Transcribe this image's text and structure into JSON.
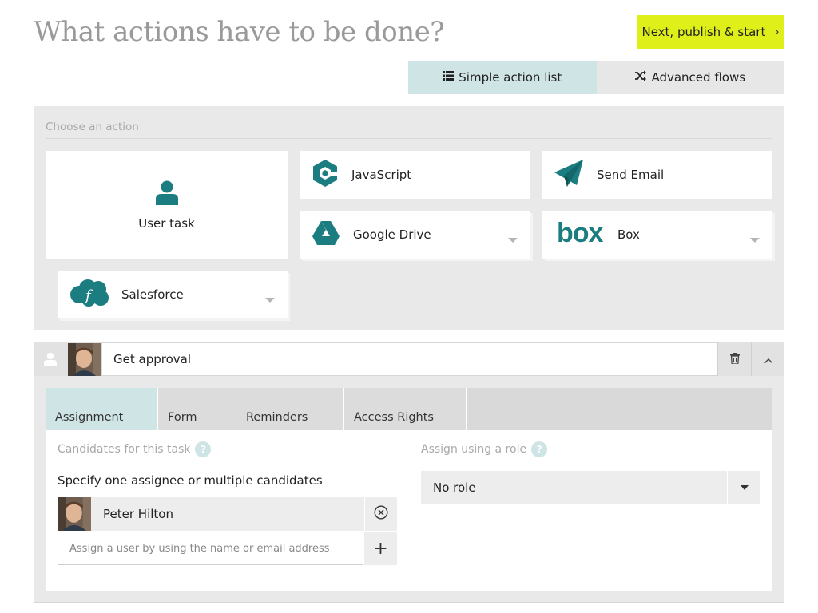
{
  "page": {
    "title": "What actions have to be done?",
    "publish_button": {
      "label": "Next, publish & start",
      "chevron": "›",
      "color": "#dfef1a"
    }
  },
  "mode_tabs": [
    {
      "label": "Simple action list",
      "icon": "list-icon",
      "active": true
    },
    {
      "label": "Advanced flows",
      "icon": "shuffle-icon",
      "active": false
    }
  ],
  "action_panel": {
    "label": "Choose an action",
    "actions": [
      {
        "label": "User task",
        "icon": "user-icon"
      },
      {
        "label": "JavaScript",
        "icon": "javascript-icon"
      },
      {
        "label": "Send Email",
        "icon": "paper-plane-icon"
      },
      {
        "label": "Google Drive",
        "icon": "google-drive-icon"
      },
      {
        "label": "Box",
        "icon": "box-logo-icon",
        "logo_text": "box"
      },
      {
        "label": "Salesforce",
        "icon": "salesforce-icon",
        "logo_text": "f"
      }
    ]
  },
  "task": {
    "name": "Get approval",
    "tabs": [
      {
        "label": "Assignment",
        "active": true
      },
      {
        "label": "Form",
        "active": false
      },
      {
        "label": "Reminders",
        "active": false
      },
      {
        "label": "Access Rights",
        "active": false
      }
    ],
    "assignment": {
      "candidates_label": "Candidates for this task",
      "specify_text": "Specify one assignee or multiple candidates",
      "candidates": [
        {
          "name": "Peter Hilton"
        }
      ],
      "input_placeholder": "Assign a user by using the name or email address",
      "input_value": "",
      "add_symbol": "+",
      "role_label": "Assign using a role",
      "role_value": "No role"
    },
    "help_symbol": "?"
  },
  "colors": {
    "accent_teal": "#1b7d80",
    "active_tab": "#cfe4e5",
    "panel_bg": "#e9e9e9",
    "title_grey": "#9a9a9a"
  }
}
